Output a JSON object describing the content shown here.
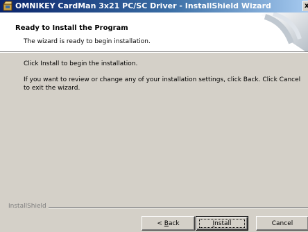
{
  "window": {
    "title": "OMNIKEY CardMan 3x21 PC/SC Driver - InstallShield Wizard",
    "close_glyph": "x"
  },
  "header": {
    "title": "Ready to Install the Program",
    "subtitle": "The wizard is ready to begin installation."
  },
  "body": {
    "line1": "Click Install to begin the installation.",
    "line2": "If you want to review or change any of your installation settings, click Back. Click Cancel to exit the wizard."
  },
  "footer": {
    "brand": "InstallShield"
  },
  "buttons": {
    "back_prefix": "< ",
    "back_accel": "B",
    "back_rest": "ack",
    "install_accel": "I",
    "install_rest": "nstall",
    "cancel": "Cancel"
  },
  "colors": {
    "titlebar_start": "#0a246a",
    "titlebar_end": "#a6caf0",
    "dialog_face": "#d4d0c8",
    "header_bg": "#ffffff"
  },
  "icons": {
    "title_icon": "installer-box-icon",
    "header_graphic": "installshield-graphic"
  }
}
